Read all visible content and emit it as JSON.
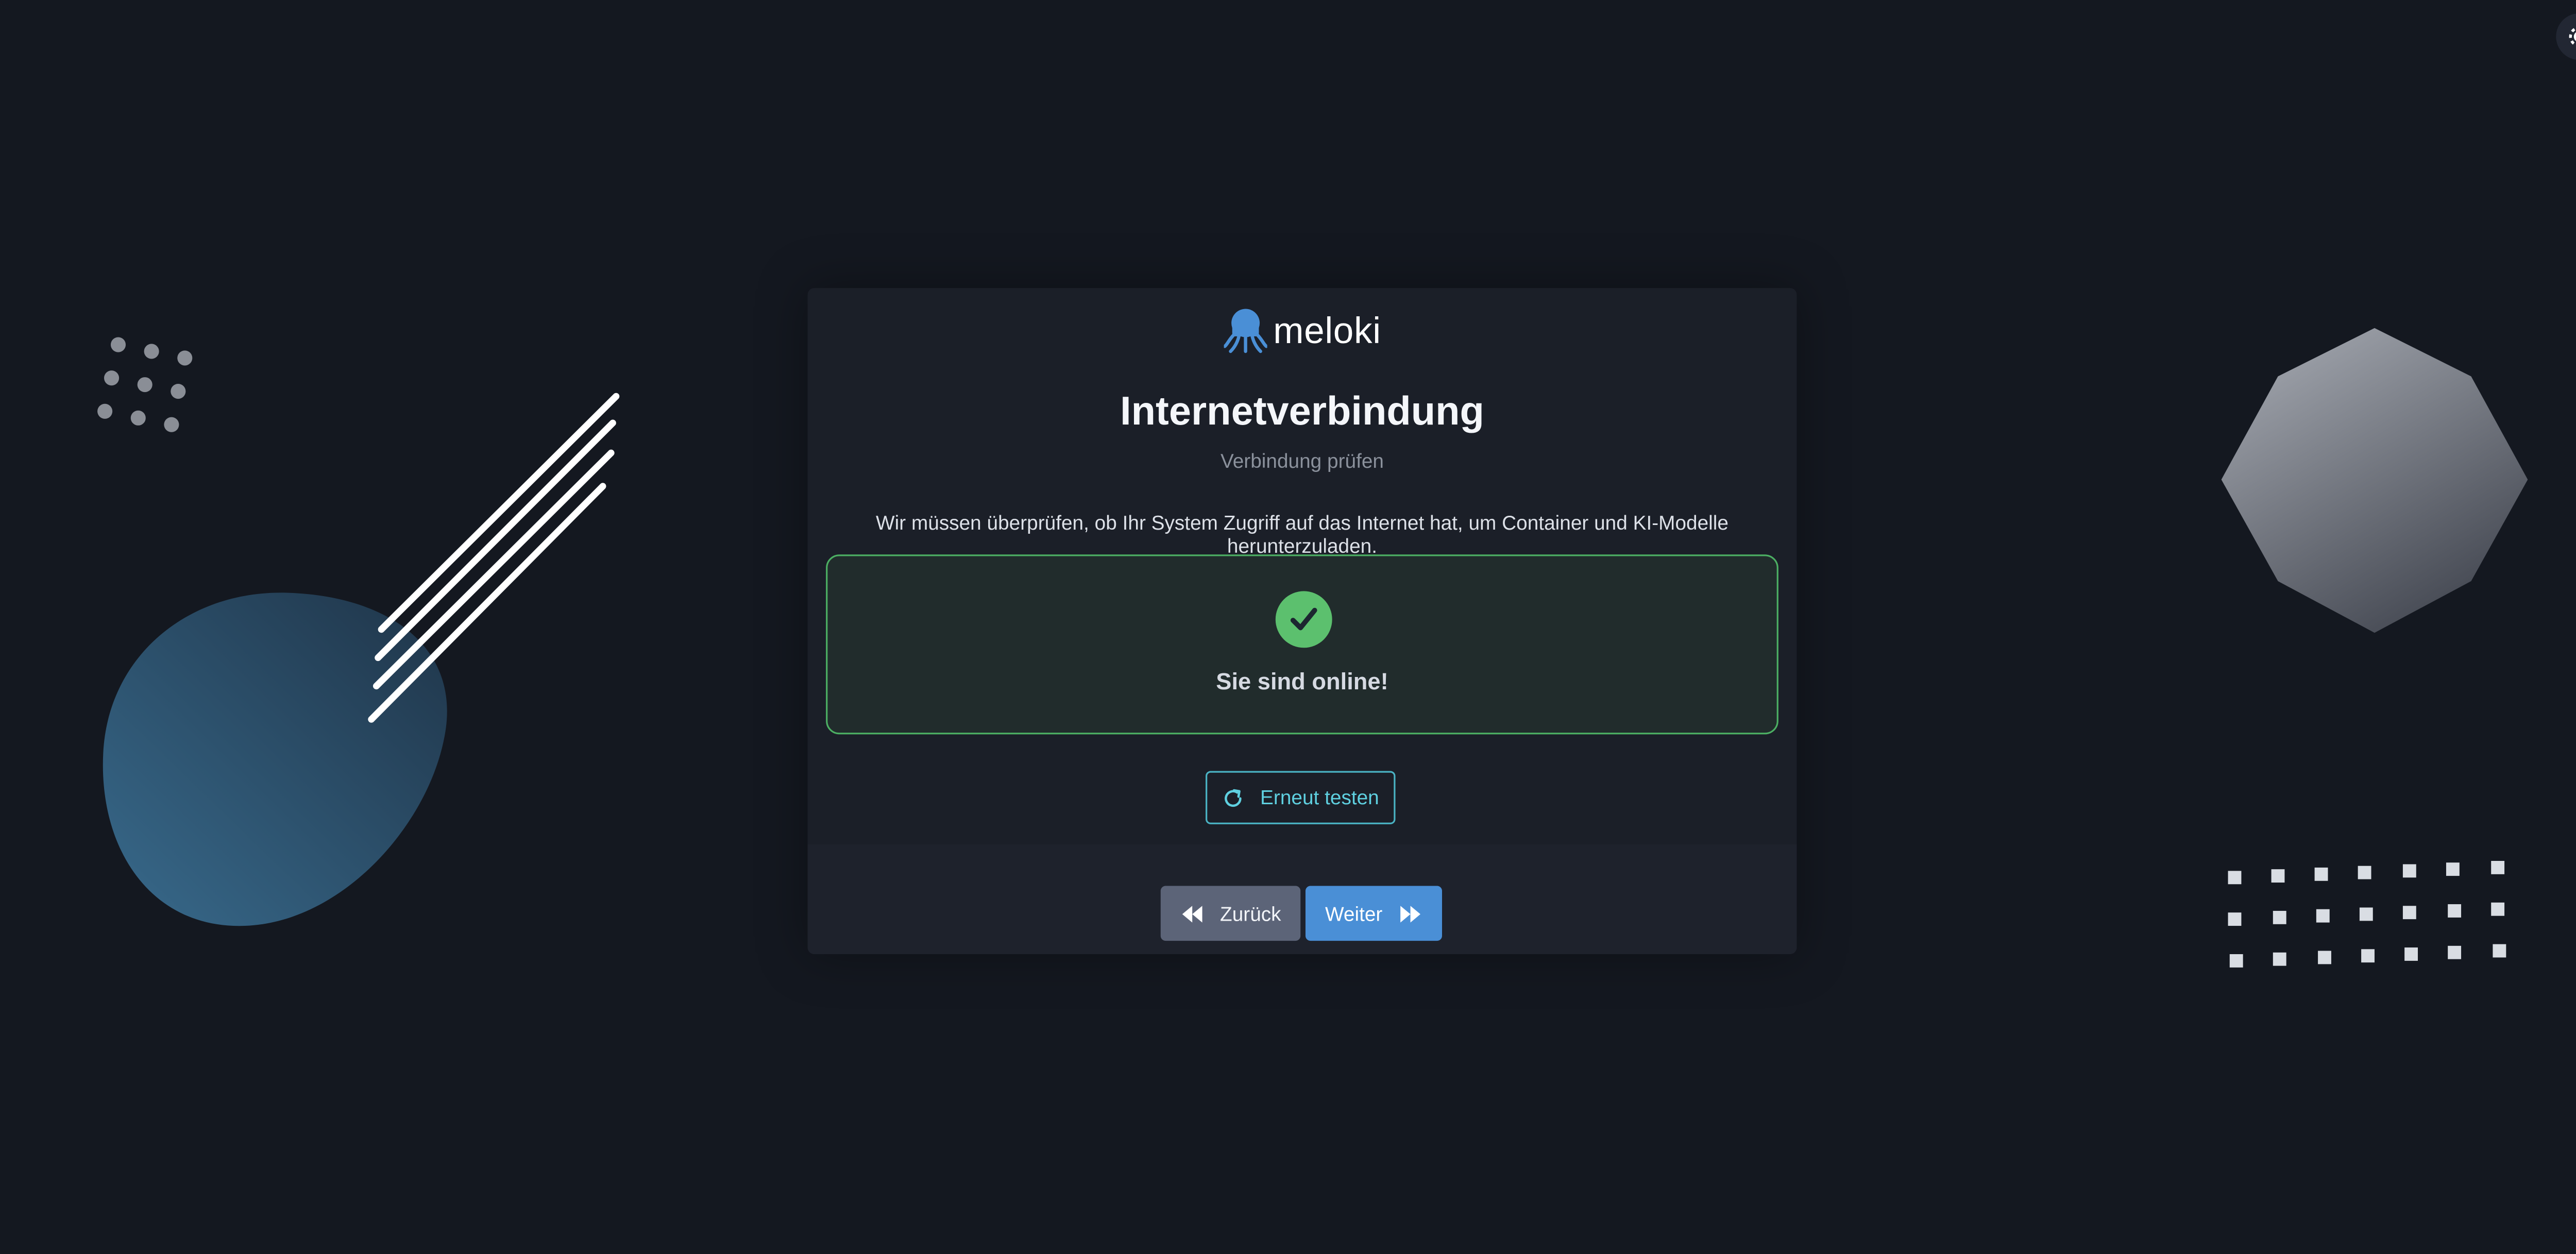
{
  "brand": {
    "name": "meloki",
    "logo_icon": "octopus-icon",
    "accent": "#4a8fd6"
  },
  "header": {
    "theme_toggle_icon": "gear-icon"
  },
  "page": {
    "title": "Internetverbindung",
    "subtitle": "Verbindung prüfen",
    "description": "Wir müssen überprüfen, ob Ihr System Zugriff auf das Internet hat, um Container und KI-Modelle herunterzuladen."
  },
  "status": {
    "icon": "checkmark-icon",
    "text": "Sie sind online!",
    "color": "#5cc06e"
  },
  "actions": {
    "retest_label": "Erneut testen",
    "retest_icon": "refresh-icon",
    "back_label": "Zurück",
    "back_icon": "double-chevron-left-icon",
    "next_label": "Weiter",
    "next_icon": "double-chevron-right-icon"
  }
}
